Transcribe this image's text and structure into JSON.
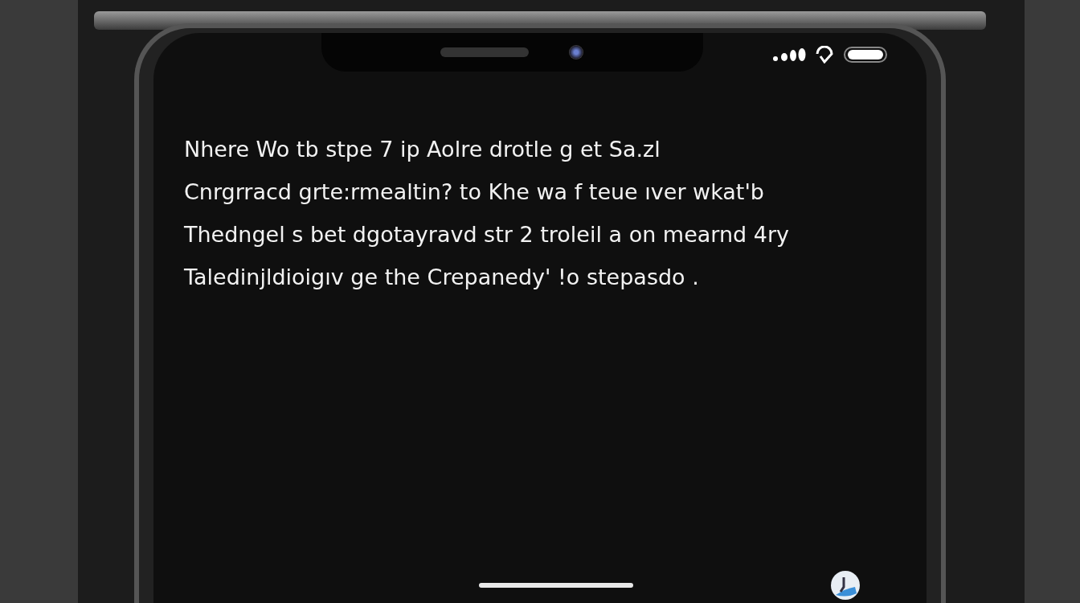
{
  "screen": {
    "message_lines": [
      "Nhere Wo tb stpe 7 ip Aolre drotle g et Sa.zl",
      "Cnrgrracd grte:rmealtin? to Khe  wa f teue ıver  wkat'b",
      "Thedngel s bet dgotayravd str  2 troleil a on mearnd 4ry",
      "Taledinjldioigıv ge  the Crepanedy' !o stepasdo ."
    ]
  }
}
